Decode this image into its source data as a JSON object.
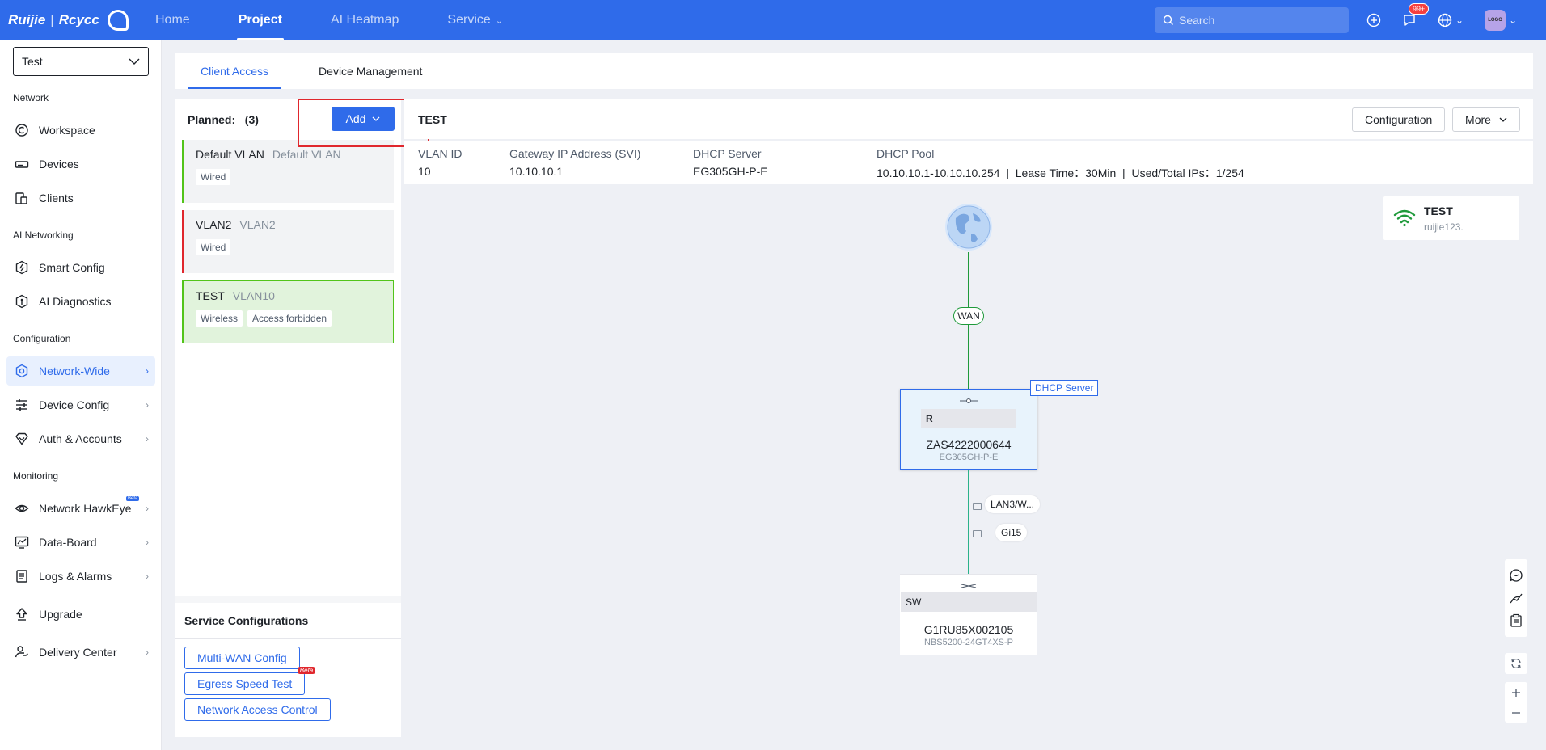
{
  "topbar": {
    "brand_left": "Ruijie",
    "brand_right": "Rcycc",
    "nav": [
      {
        "label": "Home",
        "active": false,
        "has_dropdown": false
      },
      {
        "label": "Project",
        "active": true,
        "has_dropdown": false
      },
      {
        "label": "AI Heatmap",
        "active": false,
        "has_dropdown": false
      },
      {
        "label": "Service",
        "active": false,
        "has_dropdown": true
      }
    ],
    "search_placeholder": "Search",
    "notification_badge": "99+",
    "avatar_text": "LOGO"
  },
  "sidebar": {
    "project": "Test",
    "groups": {
      "network": "Network",
      "ai_networking": "AI Networking",
      "configuration": "Configuration",
      "monitoring": "Monitoring"
    },
    "items": {
      "workspace": "Workspace",
      "devices": "Devices",
      "clients": "Clients",
      "smart_config": "Smart Config",
      "ai_diagnostics": "AI Diagnostics",
      "network_wide": "Network-Wide",
      "device_config": "Device Config",
      "auth_accounts": "Auth & Accounts",
      "network_hawkeye": "Network HawkEye",
      "data_board": "Data-Board",
      "logs_alarms": "Logs & Alarms",
      "upgrade": "Upgrade",
      "delivery_center": "Delivery Center"
    },
    "hawkeye_badge": "Beta"
  },
  "tabs": [
    "Client Access",
    "Device Management"
  ],
  "vlan_list": {
    "planned_label": "Planned:",
    "planned_count": "(3)",
    "add_label": "Add",
    "items": [
      {
        "name": "Default VLAN",
        "sub": "Default VLAN",
        "tags": [
          "Wired"
        ]
      },
      {
        "name": "VLAN2",
        "sub": "VLAN2",
        "tags": [
          "Wired"
        ]
      },
      {
        "name": "TEST",
        "sub": "VLAN10",
        "tags": [
          "Wireless",
          "Access forbidden"
        ]
      }
    ]
  },
  "services": {
    "title": "Service Configurations",
    "buttons": [
      "Multi-WAN Config",
      "Egress Speed Test",
      "Network Access Control"
    ],
    "beta_label": "Beta"
  },
  "detail": {
    "title": "TEST",
    "configuration_label": "Configuration",
    "more_label": "More",
    "info": {
      "vlan_id_label": "VLAN ID",
      "vlan_id": "10",
      "gateway_label": "Gateway IP Address (SVI)",
      "gateway": "10.10.10.1",
      "dhcp_server_label": "DHCP Server",
      "dhcp_server": "EG305GH-P-E",
      "dhcp_pool_label": "DHCP Pool",
      "dhcp_pool": "10.10.10.1-10.10.10.254  |  Lease Time：30Min  |  Used/Total IPs：1/254"
    }
  },
  "topology": {
    "wan_label": "WAN",
    "dhcp_tag": "DHCP Server",
    "router": {
      "sn": "ZAS4222000644",
      "model": "EG305GH-P-E",
      "badge": "R"
    },
    "switch": {
      "sn": "G1RU85X002105",
      "model": "NBS5200-24GT4XS-P",
      "badge": "SW"
    },
    "ports": [
      "LAN3/W...",
      "Gi15"
    ],
    "ssid": {
      "name": "TEST",
      "password": "ruijie123."
    }
  },
  "colors": {
    "primary": "#2f6bea",
    "link_green": "#1f9a3b",
    "downlink_teal": "#2bb28a",
    "alert_red": "#e0272d"
  }
}
